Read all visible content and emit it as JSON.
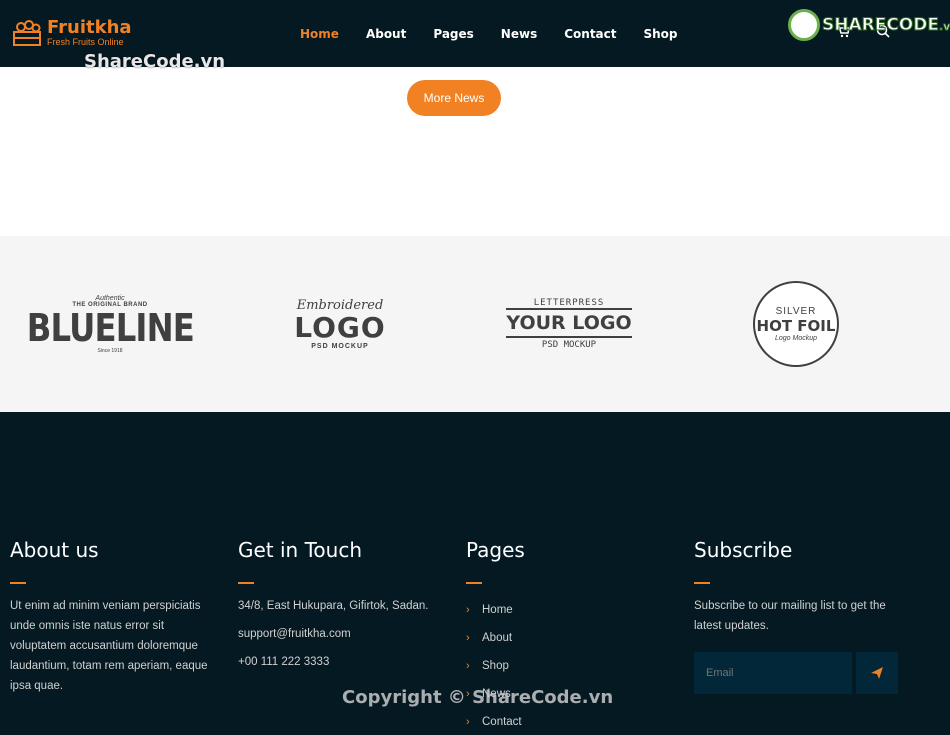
{
  "header": {
    "brand_name": "Fruitkha",
    "brand_tagline": "Fresh Fruits Online",
    "nav": [
      {
        "label": "Home",
        "active": true
      },
      {
        "label": "About"
      },
      {
        "label": "Pages"
      },
      {
        "label": "News"
      },
      {
        "label": "Contact"
      },
      {
        "label": "Shop"
      }
    ],
    "icons": [
      "cart-icon",
      "search-icon"
    ]
  },
  "watermark": {
    "badge_text": "SHARECODE",
    "badge_suffix": ".vn",
    "top_text": "ShareCode.vn",
    "bottom_text": "Copyright © ShareCode.vn"
  },
  "news": {
    "more_button": "More News"
  },
  "brands": [
    {
      "line1": "Authentic",
      "line2": "THE ORIGINAL BRAND",
      "main": "BLUELINE",
      "line3": "Since 1918"
    },
    {
      "line1": "Embroidered",
      "main": "LOGO",
      "line3": "PSD MOCKUP"
    },
    {
      "line1": "LETTERPRESS",
      "main": "YOUR LOGO",
      "line3": "PSD MOCKUP"
    },
    {
      "line1": "SILVER",
      "main": "HOT FOIL",
      "line3": "Logo Mockup"
    }
  ],
  "footer": {
    "about": {
      "title": "About us",
      "text": "Ut enim ad minim veniam perspiciatis unde omnis iste natus error sit voluptatem accusantium doloremque laudantium, totam rem aperiam, eaque ipsa quae."
    },
    "contact": {
      "title": "Get in Touch",
      "address": "34/8, East Hukupara, Gifirtok, Sadan.",
      "email": "support@fruitkha.com",
      "phone": "+00 111 222 3333"
    },
    "pages": {
      "title": "Pages",
      "links": [
        "Home",
        "About",
        "Shop",
        "News",
        "Contact"
      ]
    },
    "subscribe": {
      "title": "Subscribe",
      "text": "Subscribe to our mailing list to get the latest updates.",
      "placeholder": "Email"
    }
  },
  "colors": {
    "accent": "#f28123",
    "dark": "#051922",
    "input_bg": "#012738",
    "band": "#f5f5f5"
  }
}
